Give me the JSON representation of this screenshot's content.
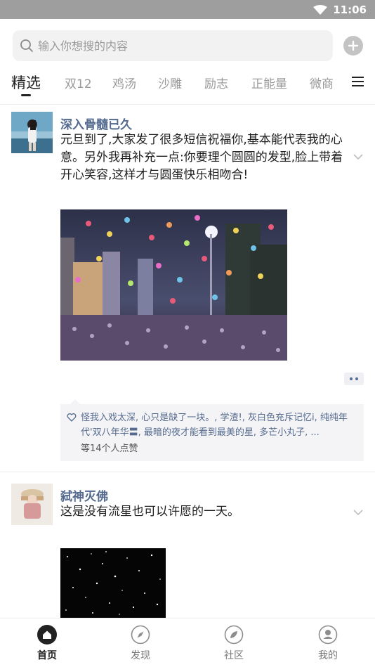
{
  "status_bar": {
    "time": "11:06"
  },
  "search": {
    "placeholder": "输入你想搜的内容"
  },
  "tabs": [
    {
      "label": "精选",
      "active": true
    },
    {
      "label": "双12"
    },
    {
      "label": "鸡汤"
    },
    {
      "label": "沙雕"
    },
    {
      "label": "励志"
    },
    {
      "label": "正能量"
    },
    {
      "label": "微商"
    }
  ],
  "posts": [
    {
      "author": "深入骨髓已久",
      "text": "元旦到了,大家发了很多短信祝福你,基本能代表我的心意。另外我再补充一点:你要理个圆圆的发型,脸上带着开心笑容,这样才与圆蛋快乐相吻合!",
      "likes_names": "怪我入戏太深, 心只是缺了一块。, 学渣!, 灰白色充斥记忆i, 纯纯年代'双八年华〓, 最暗的夜才能看到最美的星, 多芒小丸子, ...",
      "likes_count": "等14个人点赞"
    },
    {
      "author": "弑神灭佛",
      "text": "这是没有流星也可以许愿的一天。"
    }
  ],
  "bottom_nav": [
    {
      "label": "首页",
      "icon": "home-icon",
      "active": true
    },
    {
      "label": "发现",
      "icon": "compass-icon"
    },
    {
      "label": "社区",
      "icon": "community-icon"
    },
    {
      "label": "我的",
      "icon": "profile-icon"
    }
  ],
  "colors": {
    "author": "#546a8f",
    "status_bar": "#9e9e9e",
    "active_nav": "#222222"
  }
}
